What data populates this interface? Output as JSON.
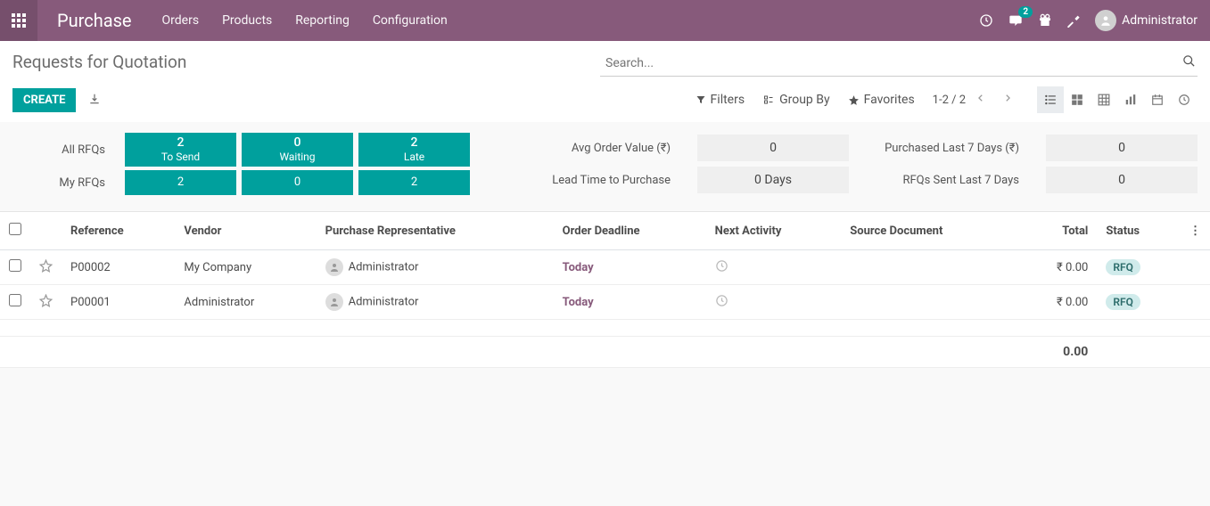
{
  "top": {
    "brand": "Purchase",
    "nav": [
      "Orders",
      "Products",
      "Reporting",
      "Configuration"
    ],
    "msg_badge": "2",
    "user": "Administrator"
  },
  "header": {
    "title": "Requests for Quotation",
    "search_placeholder": "Search...",
    "create": "CREATE",
    "filters": "Filters",
    "group_by": "Group By",
    "favorites": "Favorites",
    "pager": "1-2 / 2"
  },
  "stats": {
    "all_label": "All RFQs",
    "my_label": "My RFQs",
    "cols": [
      {
        "top_n": "2",
        "top_t": "To Send",
        "bot": "2"
      },
      {
        "top_n": "0",
        "top_t": "Waiting",
        "bot": "0"
      },
      {
        "top_n": "2",
        "top_t": "Late",
        "bot": "2"
      }
    ],
    "kpi": {
      "avg_label": "Avg Order Value (₹)",
      "avg_val": "0",
      "lead_label": "Lead Time to Purchase",
      "lead_val": "0  Days",
      "p7_label": "Purchased Last 7 Days (₹)",
      "p7_val": "0",
      "s7_label": "RFQs Sent Last 7 Days",
      "s7_val": "0"
    }
  },
  "table": {
    "headers": {
      "ref": "Reference",
      "vendor": "Vendor",
      "rep": "Purchase Representative",
      "deadline": "Order Deadline",
      "activity": "Next Activity",
      "source": "Source Document",
      "total": "Total",
      "status": "Status"
    },
    "rows": [
      {
        "ref": "P00002",
        "vendor": "My Company",
        "rep": "Administrator",
        "deadline": "Today",
        "total": "₹ 0.00",
        "status": "RFQ"
      },
      {
        "ref": "P00001",
        "vendor": "Administrator",
        "rep": "Administrator",
        "deadline": "Today",
        "total": "₹ 0.00",
        "status": "RFQ"
      }
    ],
    "grand_total": "0.00"
  }
}
